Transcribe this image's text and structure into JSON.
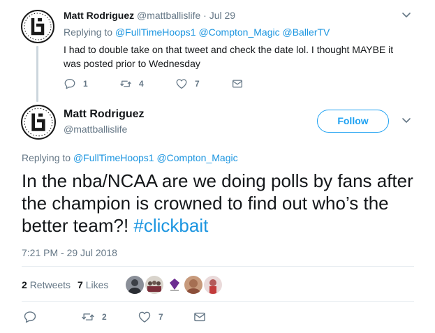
{
  "parent_tweet": {
    "author_name": "Matt Rodriguez",
    "author_handle": "@mattballislife",
    "separator": "·",
    "date": "Jul 29",
    "replying_prefix": "Replying to",
    "replying_handles": "@FullTimeHoops1 @Compton_Magic @BallerTV",
    "text": "I had to double take on that tweet and check the date lol. I thought MAYBE it was posted prior to Wednesday",
    "reply_count": "1",
    "retweet_count": "4",
    "like_count": "7"
  },
  "main_tweet": {
    "author_name": "Matt Rodriguez",
    "author_handle": "@mattballislife",
    "follow_label": "Follow",
    "replying_prefix": "Replying to",
    "replying_handles": "@FullTimeHoops1 @Compton_Magic",
    "text": "In the nba/NCAA are we doing polls by fans after the champion is crowned to find out who’s the better team?! ",
    "hashtag": "#clickbait",
    "timestamp": "7:21 PM - 29 Jul 2018",
    "retweets_count": "2",
    "retweets_label": "Retweets",
    "likes_count": "7",
    "likes_label": "Likes",
    "action_retweet_count": "2",
    "action_like_count": "7"
  },
  "colors": {
    "link": "#1b95e0",
    "muted": "#657786",
    "follow": "#1da1f2",
    "divider": "#e6ecf0"
  },
  "icons": {
    "avatar": "ballislife-logo-avatar",
    "reply": "reply-icon",
    "retweet": "retweet-icon",
    "like": "heart-icon",
    "message": "envelope-icon",
    "more": "chevron-down-icon"
  }
}
